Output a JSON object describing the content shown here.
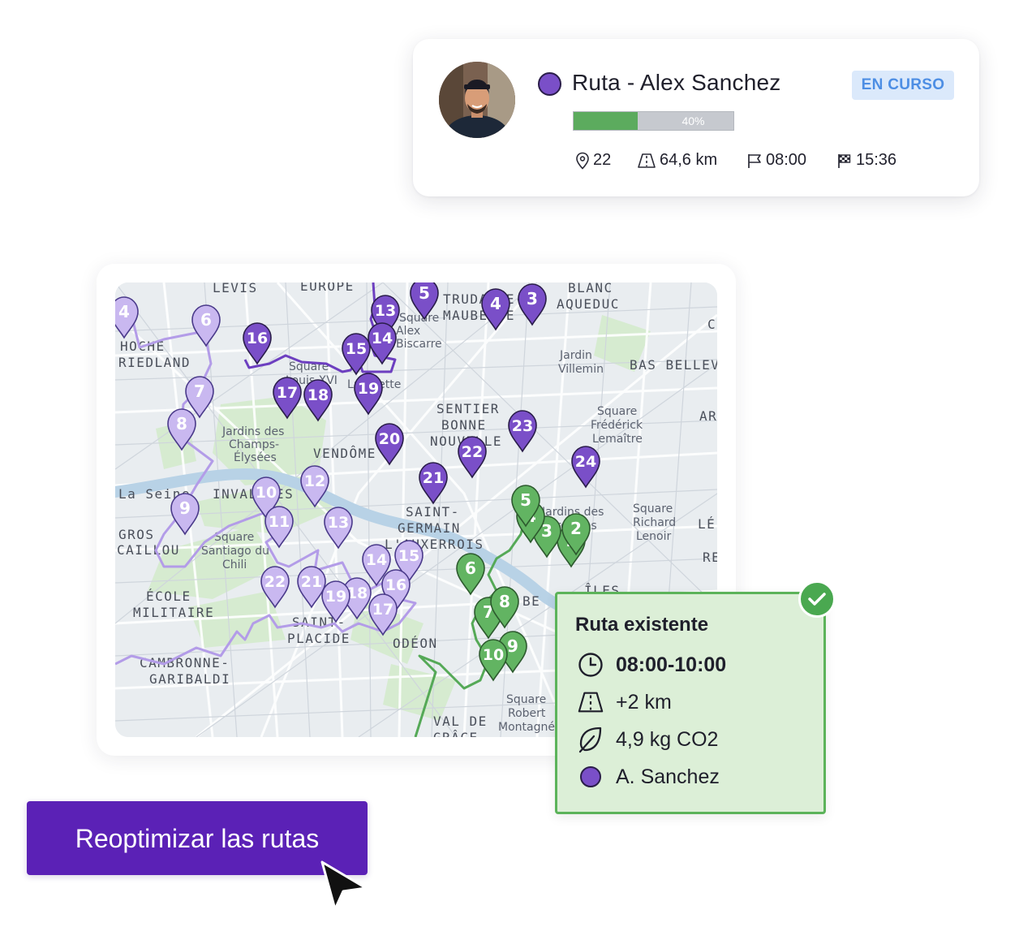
{
  "route_card": {
    "title": "Ruta - Alex Sanchez",
    "status": "EN CURSO",
    "progress_percent": 40,
    "progress_label": "40%",
    "stats": {
      "stops": "22",
      "distance": "64,6 km",
      "start_time": "08:00",
      "end_time": "15:36"
    }
  },
  "map": {
    "district_labels": [
      "LEVIS",
      "EUROPE",
      "TRUDAINE-",
      "MAUBEUGE",
      "BLANC",
      "AQUEDUC",
      "HOCHE",
      "RIEDLAND",
      "SENTIER",
      "BONNE",
      "NOUVELLE",
      "VENDÔME",
      "SAINT-",
      "GERMAIN",
      "L'AUXERROIS",
      "INVALIDES",
      "GROS",
      "CAILLOU",
      "ÉCOLE",
      "MILITAIRE",
      "SAINT-",
      "PLACIDE",
      "ODÉON",
      "CAMBRONNE-",
      "GARIBALDI",
      "VAL DE",
      "GRÂCE",
      "BAS BELLEVILLE",
      "ARSENAL",
      "ÎLES",
      "BE",
      "LÉ",
      "RE",
      "C"
    ],
    "place_labels": [
      "Square",
      "Louis XVI",
      "Jardins des",
      "Champs-",
      "Élysées",
      "Square",
      "Santiago du",
      "Chili",
      "Square",
      "Frédérick",
      "Lemaître",
      "Square",
      "Richard",
      "Lenoir",
      "Jardins des",
      "Archives",
      "Jardin",
      "Villemin",
      "Square",
      "Robert",
      "Montagné",
      "La Seine",
      "Square",
      "Alex",
      "Biscarre",
      "Lafayette"
    ],
    "purple_route_pins": [
      "3",
      "4",
      "5",
      "13",
      "14",
      "15",
      "16",
      "17",
      "18",
      "19",
      "20",
      "21",
      "22",
      "23",
      "24"
    ],
    "lavender_pins": [
      "4",
      "6",
      "7",
      "8",
      "9",
      "10",
      "11",
      "12",
      "13",
      "14",
      "15",
      "16",
      "17",
      "18",
      "19",
      "21",
      "22"
    ],
    "green_pins": [
      "1",
      "2",
      "3",
      "4",
      "5",
      "6",
      "7",
      "8",
      "9",
      "10"
    ],
    "colors": {
      "purple_route": "#6d3fc0",
      "lavender_route": "#b39ce8",
      "green_route": "#55a957",
      "water": "#b9d3e6",
      "park": "#d5ebcf"
    }
  },
  "info_popup": {
    "title": "Ruta existente",
    "time_window": "08:00-10:00",
    "extra_distance": "+2 km",
    "co2": "4,9 kg CO2",
    "driver": "A. Sanchez"
  },
  "cta": {
    "label": "Reoptimizar las rutas"
  }
}
